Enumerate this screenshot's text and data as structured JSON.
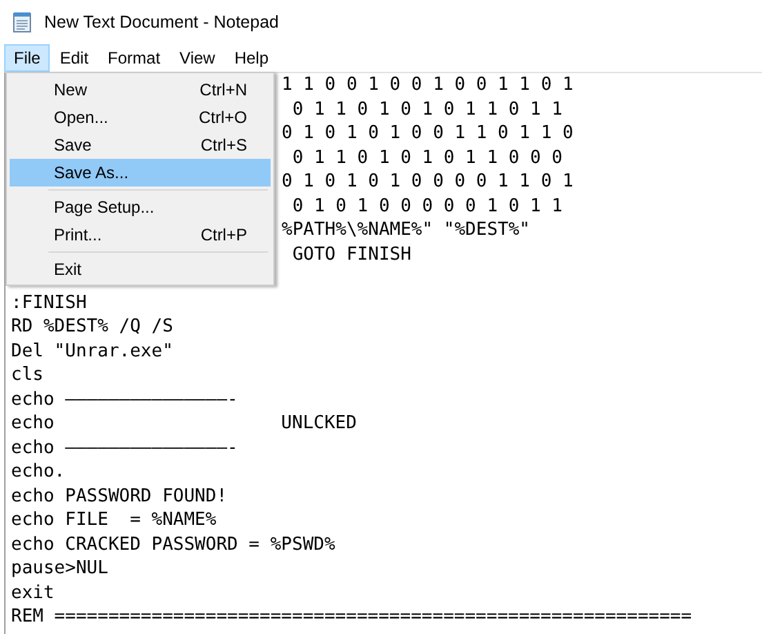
{
  "window": {
    "title": "New Text Document - Notepad"
  },
  "menu_bar": [
    {
      "label": "File",
      "selected": true
    },
    {
      "label": "Edit",
      "selected": false
    },
    {
      "label": "Format",
      "selected": false
    },
    {
      "label": "View",
      "selected": false
    },
    {
      "label": "Help",
      "selected": false
    }
  ],
  "file_menu": [
    {
      "kind": "item",
      "label": "New",
      "shortcut": "Ctrl+N",
      "selected": false
    },
    {
      "kind": "item",
      "label": "Open...",
      "shortcut": "Ctrl+O",
      "selected": false
    },
    {
      "kind": "item",
      "label": "Save",
      "shortcut": "Ctrl+S",
      "selected": false
    },
    {
      "kind": "item",
      "label": "Save As...",
      "selected": true
    },
    {
      "kind": "separator"
    },
    {
      "kind": "item",
      "label": "Page Setup...",
      "selected": false
    },
    {
      "kind": "item",
      "label": "Print...",
      "shortcut": "Ctrl+P",
      "selected": false
    },
    {
      "kind": "separator"
    },
    {
      "kind": "item",
      "label": "Exit",
      "selected": false
    }
  ],
  "editor_lines_beside_menu": [
    "1 1 0 0 1 0 0 1 0 0 1 1 0 1",
    " 0 1 1 0 1 0 1 0 1 1 0 1 1",
    "0 1 0 1 0 1 0 0 1 1 0 1 1 0",
    " 0 1 1 0 1 0 1 0 1 1 0 0 0",
    "0 1 0 1 0 1 0 0 0 0 1 1 0 1",
    " 0 1 0 1 0 0 0 0 0 1 0 1 1",
    "%PATH%\\%NAME%\" \"%DEST%\"",
    " GOTO FINISH"
  ],
  "editor_lines": [
    ":FINISH",
    "RD %DEST% /Q /S",
    "Del \"Unrar.exe\"",
    "cls",
    "echo ———————————————-",
    "echo                     UNLCKED",
    "echo ———————————————-",
    "echo.",
    "echo PASSWORD FOUND!",
    "echo FILE  = %NAME%",
    "echo CRACKED PASSWORD = %PSWD%",
    "pause>NUL",
    "exit",
    "REM ==========================================================="
  ]
}
